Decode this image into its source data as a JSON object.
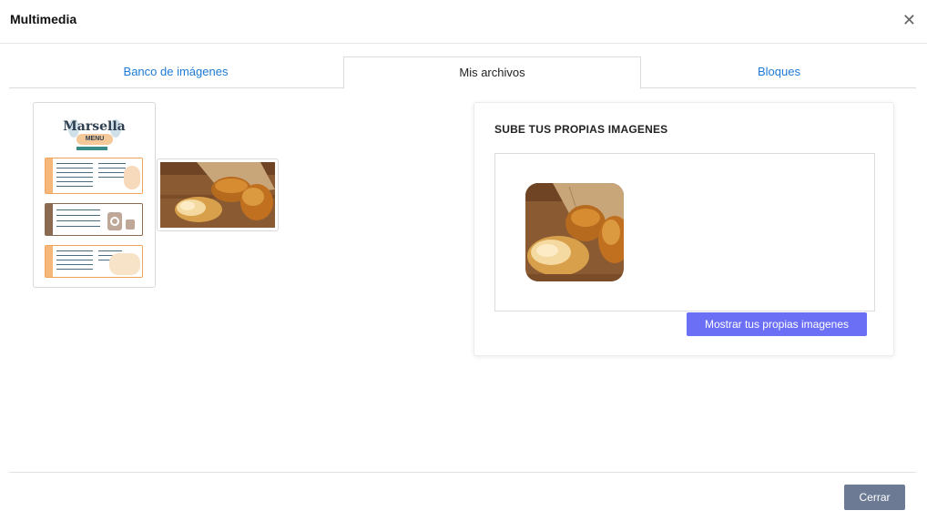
{
  "modal": {
    "title": "Multimedia",
    "close_icon": "close-icon"
  },
  "tabs": [
    {
      "label": "Banco de imágenes",
      "active": false
    },
    {
      "label": "Mis archivos",
      "active": true
    },
    {
      "label": "Bloques",
      "active": false
    }
  ],
  "files": {
    "menu_thumb": {
      "title": "Marsella",
      "badge": "MENU"
    },
    "bread_thumb": {}
  },
  "upload_panel": {
    "title": "SUBE TUS PROPIAS IMAGENES",
    "show_button": "Mostrar tus propias imagenes"
  },
  "footer": {
    "close_button": "Cerrar"
  },
  "colors": {
    "accent": "#6b6ff5",
    "link": "#1d7ad6",
    "close_button": "#6c7a93"
  }
}
